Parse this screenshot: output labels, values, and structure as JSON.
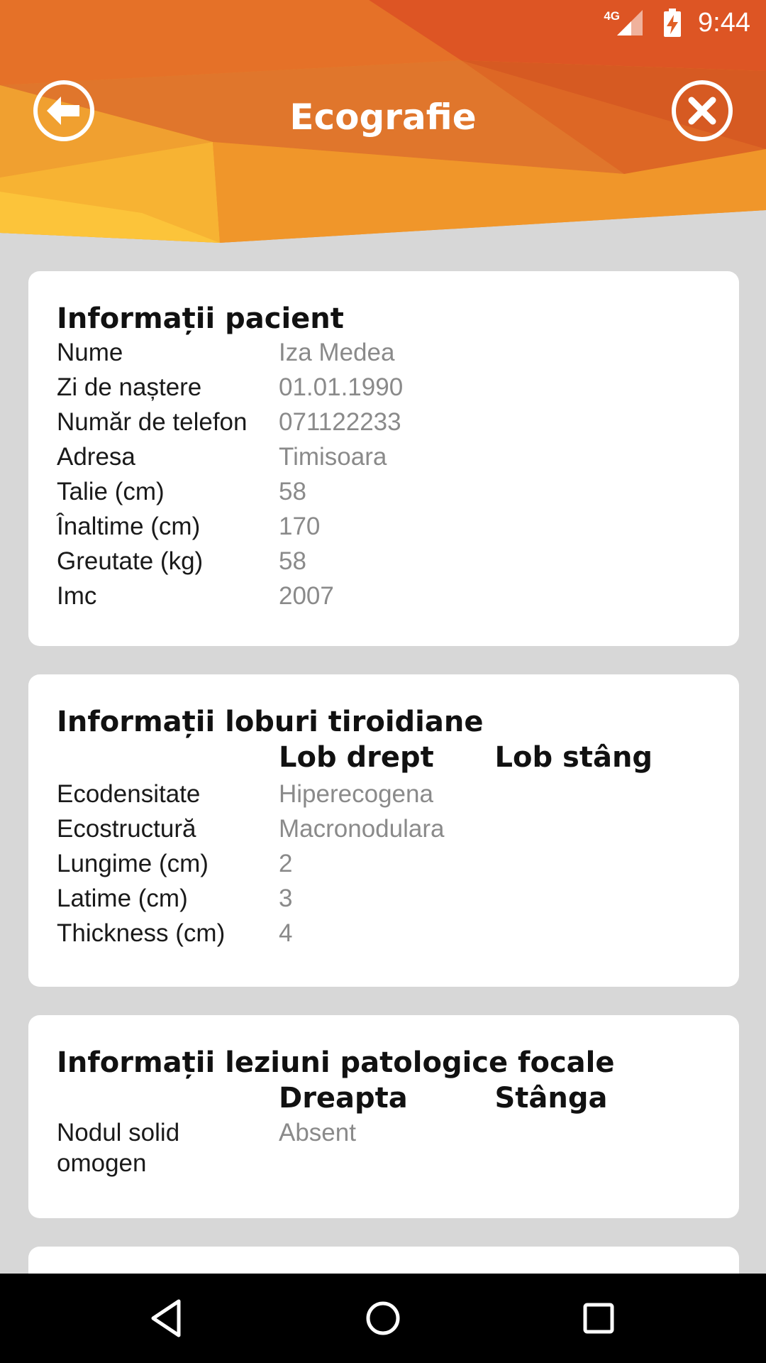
{
  "status_bar": {
    "network": "4G",
    "time": "9:44"
  },
  "header": {
    "title": "Ecografie"
  },
  "patient": {
    "title": "Informații pacient",
    "rows": [
      {
        "label": "Nume",
        "value": "Iza Medea"
      },
      {
        "label": "Zi de naștere",
        "value": "01.01.1990"
      },
      {
        "label": "Număr de telefon",
        "value": "071122233"
      },
      {
        "label": "Adresa",
        "value": "Timisoara"
      },
      {
        "label": "Talie (cm)",
        "value": "58"
      },
      {
        "label": "Înaltime (cm)",
        "value": "170"
      },
      {
        "label": "Greutate (kg)",
        "value": "58"
      },
      {
        "label": "Imc",
        "value": "2007"
      }
    ]
  },
  "lobes": {
    "title": "Informații loburi tiroidiane",
    "col_right": "Lob drept",
    "col_left": "Lob stâng",
    "rows": [
      {
        "label": "Ecodensitate",
        "value": "Hiperecogena"
      },
      {
        "label": "Ecostructură",
        "value": "Macronodulara"
      },
      {
        "label": "Lungime (cm)",
        "value": "2"
      },
      {
        "label": "Latime (cm)",
        "value": "3"
      },
      {
        "label": "Thickness (cm)",
        "value": "4"
      }
    ]
  },
  "lesions": {
    "title": "Informații leziuni patologice focale",
    "col_right": "Dreapta",
    "col_left": "Stânga",
    "rows": [
      {
        "label": "Nodul solid omogen",
        "value": "Absent"
      }
    ]
  },
  "colors": {
    "accent_orange": "#e8731f",
    "background": "#d7d7d7"
  },
  "icons": [
    "back-arrow-icon",
    "close-icon",
    "nav-back-icon",
    "nav-home-icon",
    "nav-recents-icon"
  ]
}
